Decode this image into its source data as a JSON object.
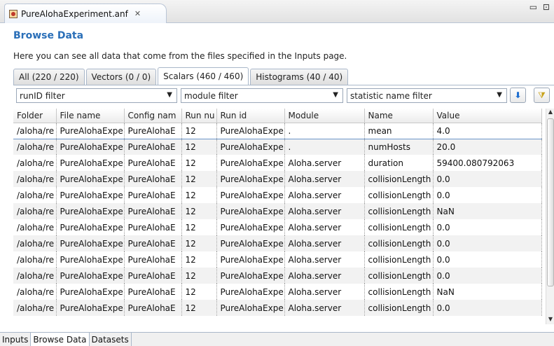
{
  "editor": {
    "tab_title": "PureAlohaExperiment.anf",
    "close_glyph": "✕",
    "window_controls": "▭ ⊡"
  },
  "page": {
    "title": "Browse Data",
    "description": "Here you can see all data that come from the files specified in the Inputs page."
  },
  "data_tabs": [
    {
      "label": "All (220 / 220)",
      "active": false
    },
    {
      "label": "Vectors (0 / 0)",
      "active": false
    },
    {
      "label": "Scalars (460 / 460)",
      "active": true
    },
    {
      "label": "Histograms (40 / 40)",
      "active": false
    }
  ],
  "filters": {
    "run_id": "runID filter",
    "module": "module filter",
    "statistic": "statistic name filter"
  },
  "table": {
    "columns": [
      "Folder",
      "File name",
      "Config nam",
      "Run nu",
      "Run id",
      "Module",
      "Name",
      "Value"
    ],
    "rows": [
      [
        "/aloha/re",
        "PureAlohaExpe",
        "PureAlohaE",
        "12",
        "PureAlohaExpe",
        ".",
        "mean",
        "4.0"
      ],
      [
        "/aloha/re",
        "PureAlohaExpe",
        "PureAlohaE",
        "12",
        "PureAlohaExpe",
        ".",
        "numHosts",
        "20.0"
      ],
      [
        "/aloha/re",
        "PureAlohaExpe",
        "PureAlohaE",
        "12",
        "PureAlohaExpe",
        "Aloha.server",
        "duration",
        "59400.080792063"
      ],
      [
        "/aloha/re",
        "PureAlohaExpe",
        "PureAlohaE",
        "12",
        "PureAlohaExpe",
        "Aloha.server",
        "collisionLength",
        "0.0"
      ],
      [
        "/aloha/re",
        "PureAlohaExpe",
        "PureAlohaE",
        "12",
        "PureAlohaExpe",
        "Aloha.server",
        "collisionLength",
        "0.0"
      ],
      [
        "/aloha/re",
        "PureAlohaExpe",
        "PureAlohaE",
        "12",
        "PureAlohaExpe",
        "Aloha.server",
        "collisionLength",
        "NaN"
      ],
      [
        "/aloha/re",
        "PureAlohaExpe",
        "PureAlohaE",
        "12",
        "PureAlohaExpe",
        "Aloha.server",
        "collisionLength",
        "0.0"
      ],
      [
        "/aloha/re",
        "PureAlohaExpe",
        "PureAlohaE",
        "12",
        "PureAlohaExpe",
        "Aloha.server",
        "collisionLength",
        "0.0"
      ],
      [
        "/aloha/re",
        "PureAlohaExpe",
        "PureAlohaE",
        "12",
        "PureAlohaExpe",
        "Aloha.server",
        "collisionLength",
        "0.0"
      ],
      [
        "/aloha/re",
        "PureAlohaExpe",
        "PureAlohaE",
        "12",
        "PureAlohaExpe",
        "Aloha.server",
        "collisionLength",
        "0.0"
      ],
      [
        "/aloha/re",
        "PureAlohaExpe",
        "PureAlohaE",
        "12",
        "PureAlohaExpe",
        "Aloha.server",
        "collisionLength",
        "NaN"
      ],
      [
        "/aloha/re",
        "PureAlohaExpe",
        "PureAlohaE",
        "12",
        "PureAlohaExpe",
        "Aloha.server",
        "collisionLength",
        "0.0"
      ]
    ]
  },
  "bottom_tabs": [
    "Inputs",
    "Browse Data",
    "Datasets"
  ],
  "icons": {
    "file": "anf-file-icon",
    "apply_filter": "arrow-down-icon",
    "clear_filter": "funnel-icon"
  },
  "colors": {
    "title": "#2a6fb8",
    "selection_border": "#6b96c8"
  }
}
